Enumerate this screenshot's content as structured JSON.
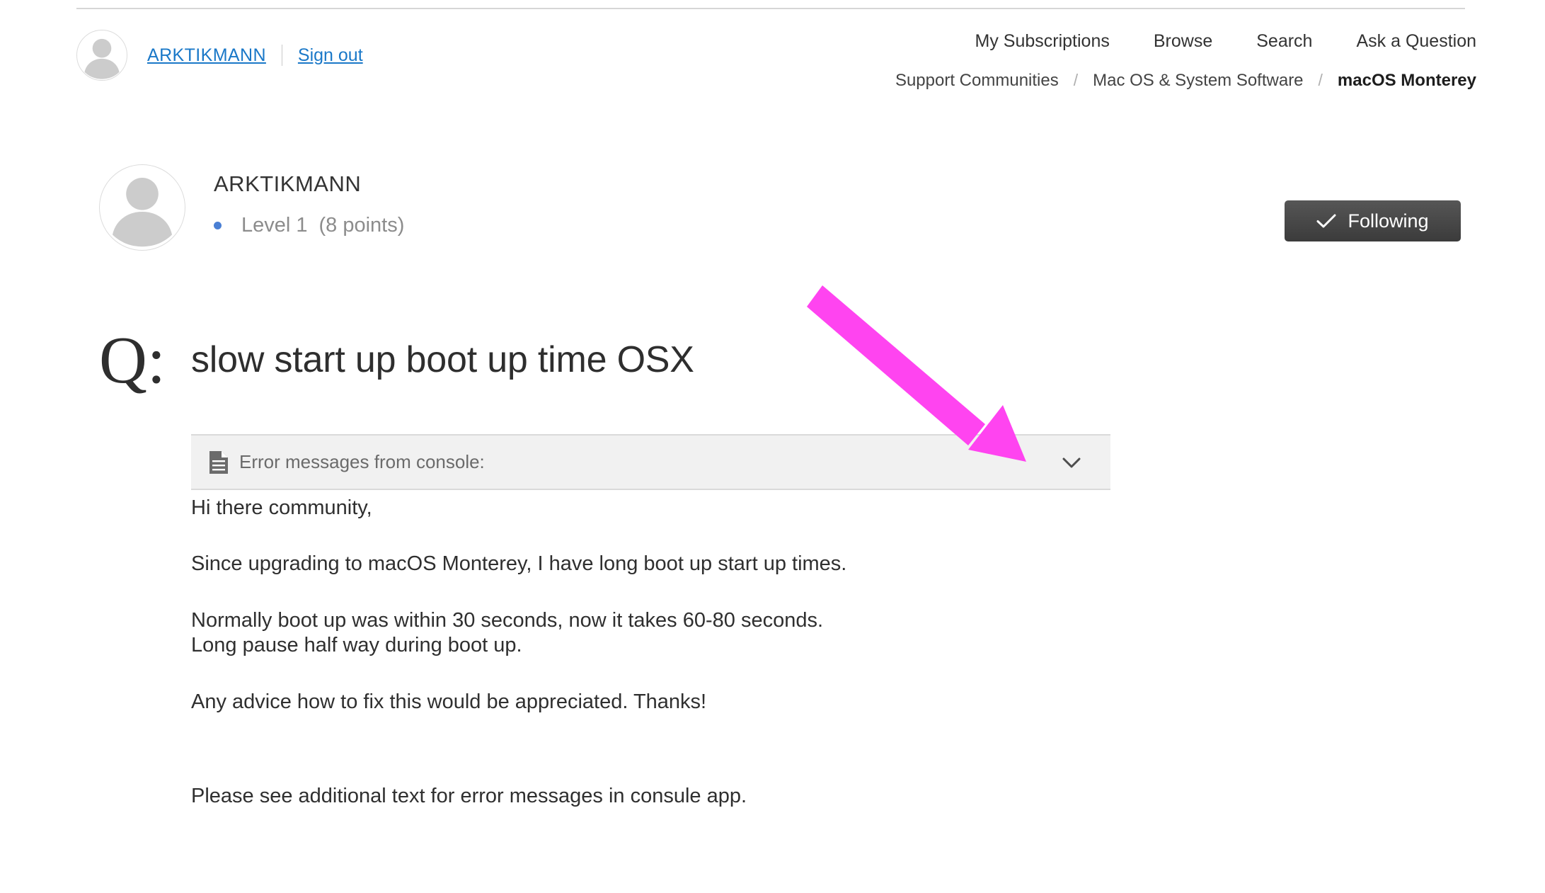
{
  "colors": {
    "link_blue": "#1a78c8",
    "annotation_magenta": "#ff44f0",
    "button_dark": "#3b3b3b",
    "level_bullet_blue": "#4a7fd4",
    "attachment_bar_bg": "#f1f1f1"
  },
  "header": {
    "avatar_icon": "person-avatar-icon",
    "username": "ARKTIKMANN",
    "sign_out": "Sign out",
    "nav": [
      "My Subscriptions",
      "Browse",
      "Search",
      "Ask a Question"
    ],
    "breadcrumb": {
      "separator": "/",
      "items": [
        "Support Communities",
        "Mac OS & System Software",
        "macOS Monterey"
      ],
      "current": "macOS Monterey"
    }
  },
  "profile": {
    "avatar_icon": "person-avatar-icon",
    "name": "ARKTIKMANN",
    "level": "Level 1",
    "points": "(8 points)"
  },
  "follow": {
    "label": "Following",
    "icon": "check-icon"
  },
  "question": {
    "prefix": "Q:",
    "title": "slow start up boot up time OSX"
  },
  "attachment": {
    "icon": "document-icon",
    "label": "Error messages from console:",
    "chevron": "chevron-down-icon"
  },
  "post": {
    "paragraphs": [
      "Hi there community,",
      "Since upgrading to macOS Monterey, I have long boot up start up times.",
      "Normally boot up was within 30 seconds, now it takes 60-80 seconds.",
      "Long pause half way during boot up.",
      "Any advice how to fix this would be appreciated. Thanks!",
      "Please see additional text for error messages in consule app."
    ]
  },
  "annotation": {
    "type": "arrow",
    "color": "#ff44f0",
    "points_to": "attachment-chevron"
  }
}
